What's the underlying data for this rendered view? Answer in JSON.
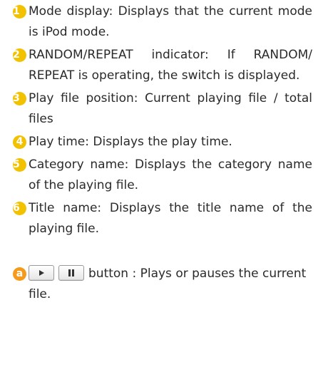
{
  "items": [
    {
      "num": "1",
      "text": "Mode display: Displays that the current mode is iPod mode."
    },
    {
      "num": "2",
      "text": "RANDOM/REPEAT indicator: If RANDOM/ REPEAT is operating, the switch is displayed."
    },
    {
      "num": "3",
      "text": "Play file position:  Current playing file / total files"
    },
    {
      "num": "4",
      "text": "Play time: Displays the play time."
    },
    {
      "num": "5",
      "text": "Category name: Displays the category name of the playing file."
    },
    {
      "num": "6",
      "text": "Title name: Displays the title name of the playing file."
    }
  ],
  "button_item": {
    "marker": "a",
    "text": "button : Plays or pauses the current file.",
    "icons": [
      "play-icon",
      "pause-icon"
    ]
  },
  "colors": {
    "number_badge": "#f2c200",
    "letter_badge": "#f59a1b",
    "text": "#2a2a2a"
  }
}
